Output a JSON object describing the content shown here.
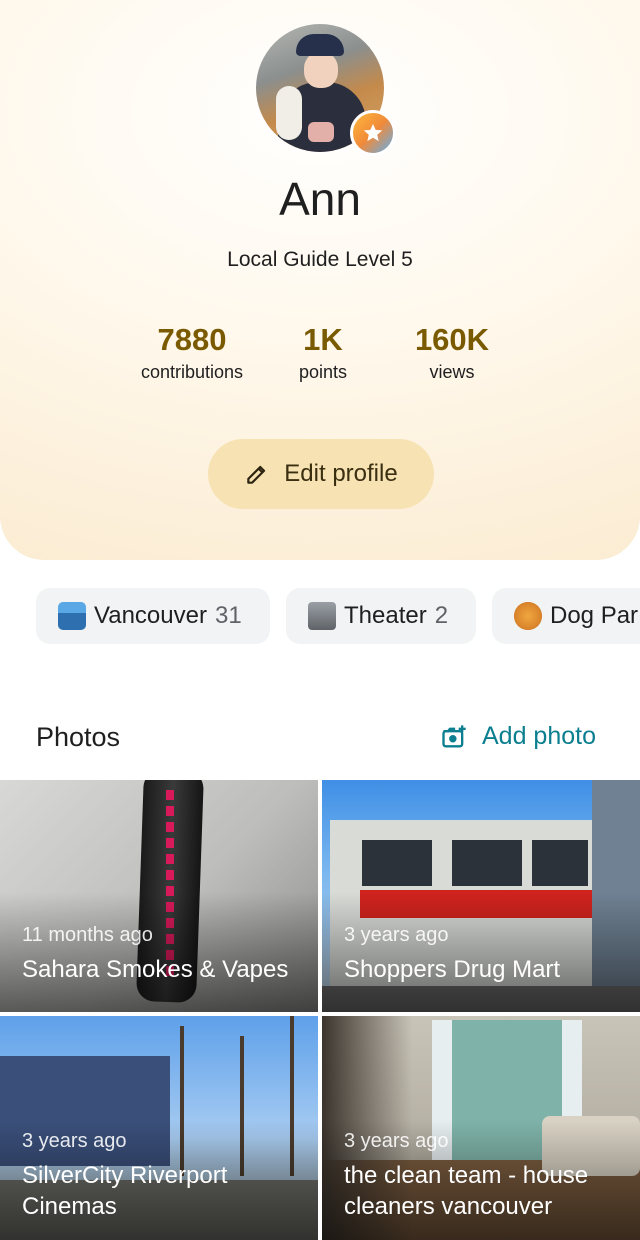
{
  "profile": {
    "name": "Ann",
    "level": "Local Guide Level 5",
    "stats": [
      {
        "value": "7880",
        "label": "contributions"
      },
      {
        "value": "1K",
        "label": "points"
      },
      {
        "value": "160K",
        "label": "views"
      }
    ],
    "edit_label": "Edit profile"
  },
  "chips": [
    {
      "label": "Vancouver",
      "count": "31",
      "icon": "cityscape-icon"
    },
    {
      "label": "Theater",
      "count": "2",
      "icon": "film-camera-icon"
    },
    {
      "label": "Dog Par",
      "count": "",
      "icon": "dog-icon"
    }
  ],
  "photos": {
    "title": "Photos",
    "add_label": "Add photo",
    "items": [
      {
        "time": "11 months ago",
        "title": "Sahara Smokes & Vapes"
      },
      {
        "time": "3 years ago",
        "title": "Shoppers Drug Mart"
      },
      {
        "time": "3 years ago",
        "title": "SilverCity Riverport Cinemas"
      },
      {
        "time": "3 years ago",
        "title": "the clean team - house cleaners vancouver"
      }
    ]
  },
  "colors": {
    "accent_teal": "#0b7f8f",
    "stat_gold": "#7a5a00",
    "edit_button_bg": "#f6e2b3",
    "chip_bg": "#f1f3f4"
  }
}
